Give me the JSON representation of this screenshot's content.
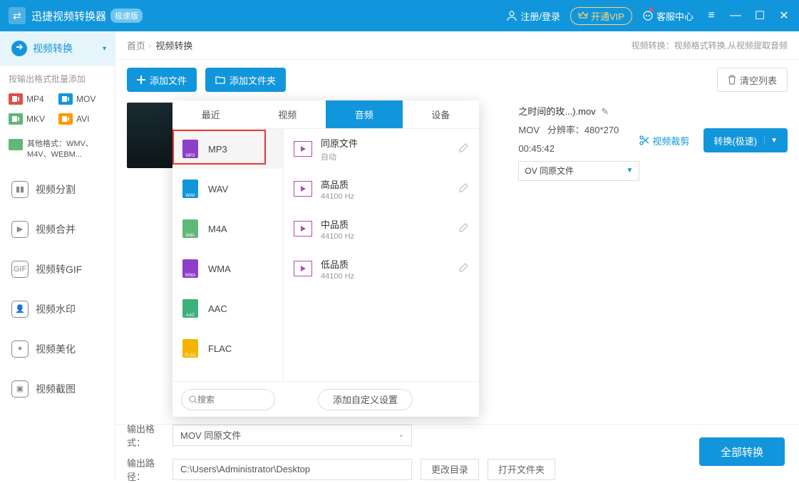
{
  "title": "迅捷视频转换器",
  "badge": "极速版",
  "header": {
    "login": "注册/登录",
    "vip": "开通VIP",
    "support": "客服中心"
  },
  "sidebar": {
    "active": "视频转换",
    "batch_label": "按输出格式批量添加",
    "formats": [
      {
        "name": "MP4",
        "color": "#e54d42"
      },
      {
        "name": "MOV",
        "color": "#1296db"
      },
      {
        "name": "MKV",
        "color": "#5fb878"
      },
      {
        "name": "AVI",
        "color": "#ff9800"
      }
    ],
    "other_formats": "其他格式：WMV、M4V、WEBM...",
    "nav": [
      {
        "label": "视频分割",
        "glyph": "▮▮"
      },
      {
        "label": "视频合并",
        "glyph": "▶"
      },
      {
        "label": "视频转GIF",
        "glyph": "GIF"
      },
      {
        "label": "视频水印",
        "glyph": "👤"
      },
      {
        "label": "视频美化",
        "glyph": "✦"
      },
      {
        "label": "视频截图",
        "glyph": "▣"
      }
    ]
  },
  "breadcrumb": {
    "home": "首页",
    "cur": "视频转换",
    "desc": "视频转换：视频格式转换,从视频提取音频"
  },
  "toolbar": {
    "add_file": "添加文件",
    "add_folder": "添加文件夹",
    "clear": "清空列表"
  },
  "file": {
    "name": "之时间的玫...).mov",
    "format_label": "MOV",
    "res_label": "分辨率：",
    "res_val": "480*270",
    "dur": "00:45:42",
    "out_fmt": "OV  同原文件",
    "trim": "视频裁剪",
    "convert": "转换(极速)"
  },
  "popup": {
    "tabs": [
      "最近",
      "视频",
      "音频",
      "设备"
    ],
    "active_tab": 2,
    "formats": [
      {
        "name": "MP3",
        "color": "#8e3fc7",
        "ext": "MP3"
      },
      {
        "name": "WAV",
        "color": "#1296db",
        "ext": "WAV"
      },
      {
        "name": "M4A",
        "color": "#5fb878",
        "ext": "M4A"
      },
      {
        "name": "WMA",
        "color": "#8e3fc7",
        "ext": "WMA"
      },
      {
        "name": "AAC",
        "color": "#3eb07a",
        "ext": "AAC"
      },
      {
        "name": "FLAC",
        "color": "#f4b400",
        "ext": "FLAC"
      }
    ],
    "selected_format": 0,
    "quality": [
      {
        "title": "同原文件",
        "sub": "自动"
      },
      {
        "title": "高品质",
        "sub": "44100 Hz"
      },
      {
        "title": "中品质",
        "sub": "44100 Hz"
      },
      {
        "title": "低品质",
        "sub": "44100 Hz"
      }
    ],
    "search_placeholder": "搜索",
    "custom": "添加自定义设置"
  },
  "footer": {
    "out_fmt_label": "输出格式：",
    "out_fmt_val": "MOV  同原文件",
    "out_path_label": "输出路径：",
    "out_path_val": "C:\\Users\\Administrator\\Desktop",
    "change_dir": "更改目录",
    "open_dir": "打开文件夹",
    "convert_all": "全部转换"
  }
}
